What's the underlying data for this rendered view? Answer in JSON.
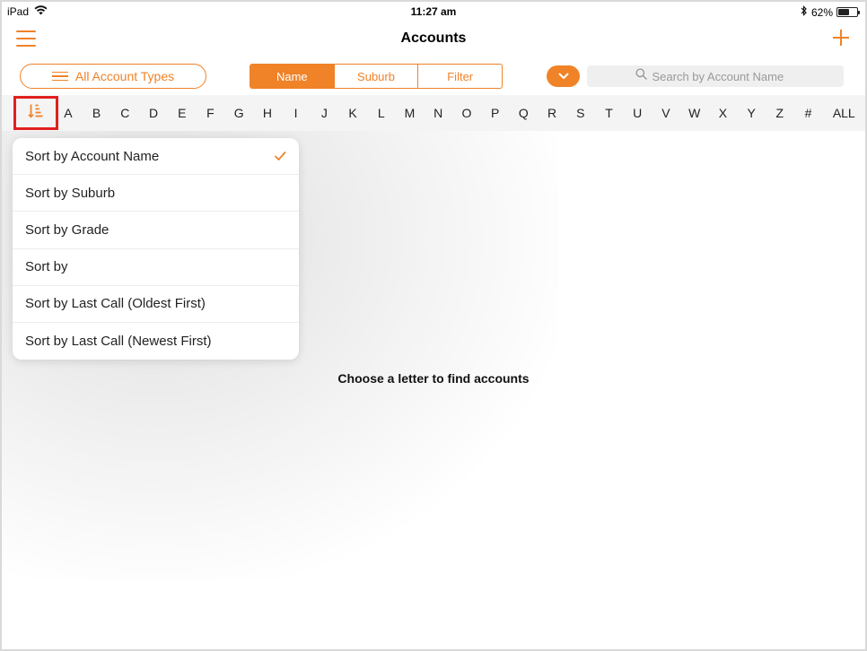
{
  "status": {
    "device": "iPad",
    "time": "11:27 am",
    "battery": "62%",
    "battery_level": 0.62
  },
  "nav": {
    "title": "Accounts"
  },
  "filters": {
    "account_types_label": "All Account Types",
    "segments": [
      "Name",
      "Suburb",
      "Filter"
    ],
    "active_segment": "Name",
    "search_placeholder": "Search by Account Name"
  },
  "letters": [
    "A",
    "B",
    "C",
    "D",
    "E",
    "F",
    "G",
    "H",
    "I",
    "J",
    "K",
    "L",
    "M",
    "N",
    "O",
    "P",
    "Q",
    "R",
    "S",
    "T",
    "U",
    "V",
    "W",
    "X",
    "Y",
    "Z",
    "#"
  ],
  "letters_all": "ALL",
  "sort_menu": {
    "items": [
      "Sort by Account Name",
      "Sort by Suburb",
      "Sort by Grade",
      "Sort by",
      "Sort by Last Call (Oldest First)",
      "Sort by Last Call (Newest First)"
    ],
    "selected": "Sort by Account Name"
  },
  "empty_message": "Choose a letter to find accounts",
  "colors": {
    "accent": "#f08228",
    "highlight_border": "#e02020"
  },
  "icons": [
    "wifi-icon",
    "bluetooth-icon",
    "battery-icon",
    "menu-icon",
    "add-icon",
    "list-icon",
    "chevron-down-icon",
    "search-icon",
    "sort-icon",
    "checkmark-icon"
  ]
}
